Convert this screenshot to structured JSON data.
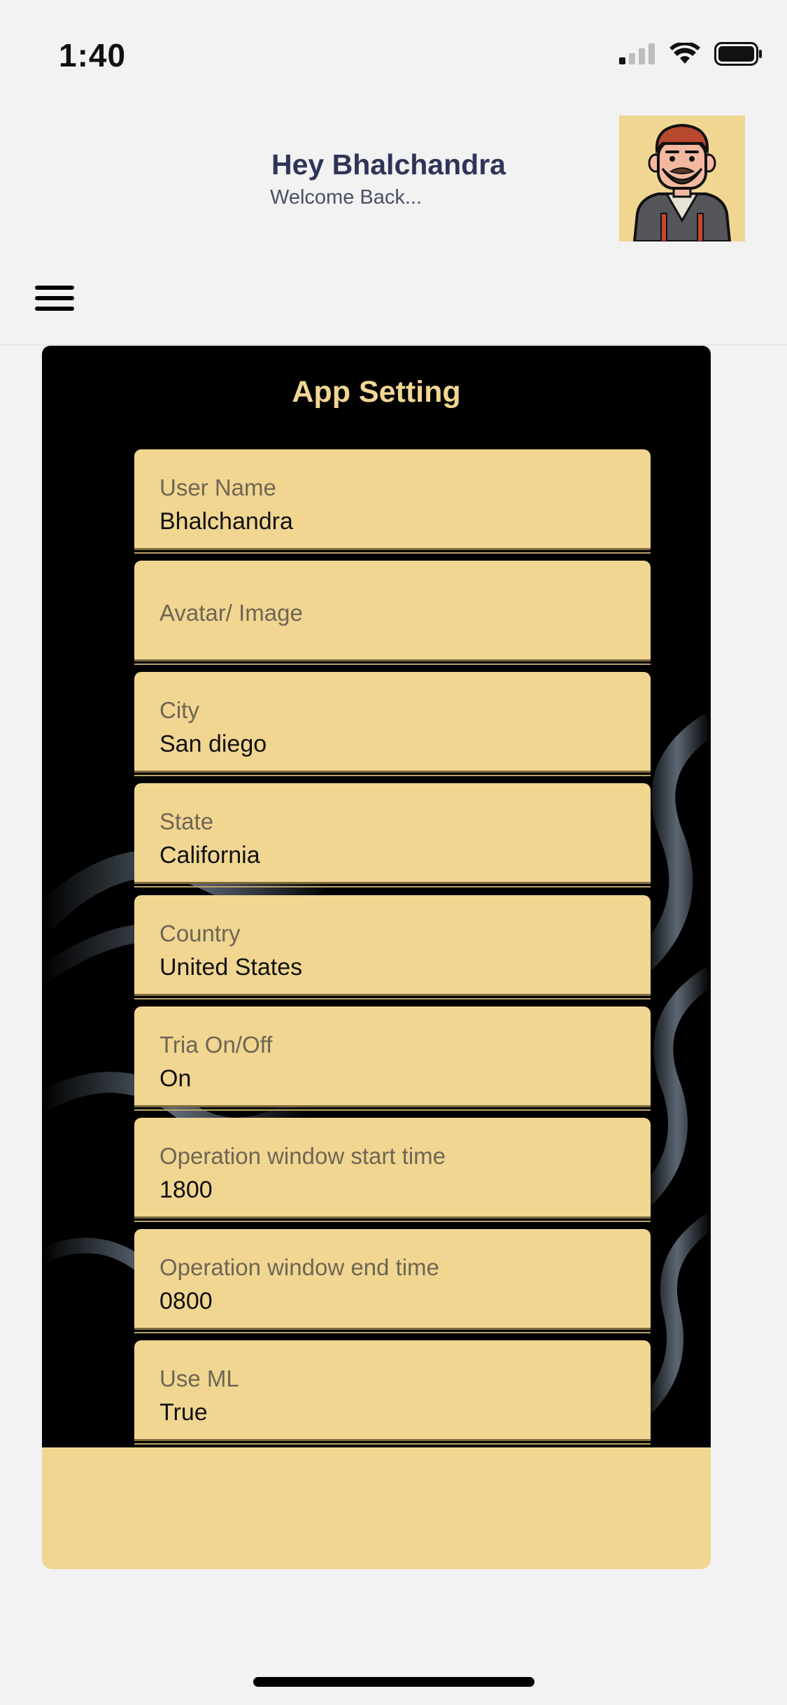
{
  "status_bar": {
    "time": "1:40"
  },
  "header": {
    "greeting": "Hey Bhalchandra",
    "subtitle": "Welcome Back...",
    "avatar_icon": "man-with-beard-avatar-icon",
    "menu_icon": "hamburger-menu-icon"
  },
  "settings": {
    "title": "App Setting",
    "fields": [
      {
        "label": "User Name",
        "value": "Bhalchandra"
      },
      {
        "label": "Avatar/ Image",
        "value": ""
      },
      {
        "label": "City",
        "value": "San diego"
      },
      {
        "label": "State",
        "value": "California"
      },
      {
        "label": "Country",
        "value": "United States"
      },
      {
        "label": "Tria On/Off",
        "value": "On"
      },
      {
        "label": "Operation window start time",
        "value": "1800"
      },
      {
        "label": "Operation window end time",
        "value": "0800"
      },
      {
        "label": "Use ML",
        "value": "True"
      }
    ]
  },
  "colors": {
    "accent": "#f1d692",
    "header_text": "#2e3557",
    "card_background": "#000000",
    "page_background": "#f2f2f3"
  }
}
